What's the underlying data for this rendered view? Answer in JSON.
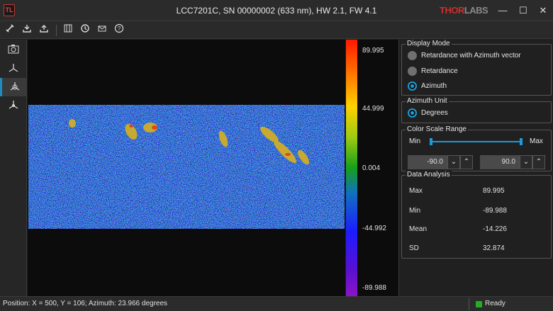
{
  "window": {
    "app_icon": "TL",
    "title": "LCC7201C, SN 00000002 (633 nm), HW 2.1, FW 4.1",
    "brand_red": "THOR",
    "brand_gray": "LABS",
    "minimize": "—",
    "maximize": "☐",
    "close": "✕"
  },
  "toolbar": {
    "icons": [
      "connect-icon",
      "export-icon",
      "import-icon",
      "grid-icon",
      "refresh-icon",
      "mail-icon",
      "help-icon"
    ]
  },
  "sidebar": {
    "items": [
      {
        "name": "camera-icon",
        "active": false
      },
      {
        "name": "azimuth-vector-icon",
        "active": false
      },
      {
        "name": "azimuth-map-icon",
        "active": true
      },
      {
        "name": "analysis-icon",
        "active": false
      }
    ]
  },
  "colorbar": {
    "labels": [
      "89.995",
      "44.999",
      "0.004",
      "-44.992",
      "-89.988"
    ]
  },
  "display_mode": {
    "title": "Display Mode",
    "options": [
      {
        "label": "Retardance with Azimuth vector",
        "selected": false
      },
      {
        "label": "Retardance",
        "selected": false
      },
      {
        "label": "Azimuth",
        "selected": true
      }
    ]
  },
  "azimuth_unit": {
    "title": "Azimuth Unit",
    "options": [
      {
        "label": "Degrees",
        "selected": true
      }
    ]
  },
  "color_scale": {
    "title": "Color Scale Range",
    "min_label": "Min",
    "max_label": "Max",
    "min_value": "-90.0",
    "max_value": "90.0",
    "down": "⌄",
    "up": "⌃"
  },
  "data_analysis": {
    "title": "Data Analysis",
    "rows": [
      {
        "key": "Max",
        "value": "89.995"
      },
      {
        "key": "Min",
        "value": "-89.988"
      },
      {
        "key": "Mean",
        "value": "-14.226"
      },
      {
        "key": "SD",
        "value": "32.874"
      }
    ]
  },
  "status": {
    "text": "Position: X = 500, Y = 106; Azimuth: 23.966 degrees",
    "ready": "Ready",
    "ready_color": "#21b021"
  }
}
